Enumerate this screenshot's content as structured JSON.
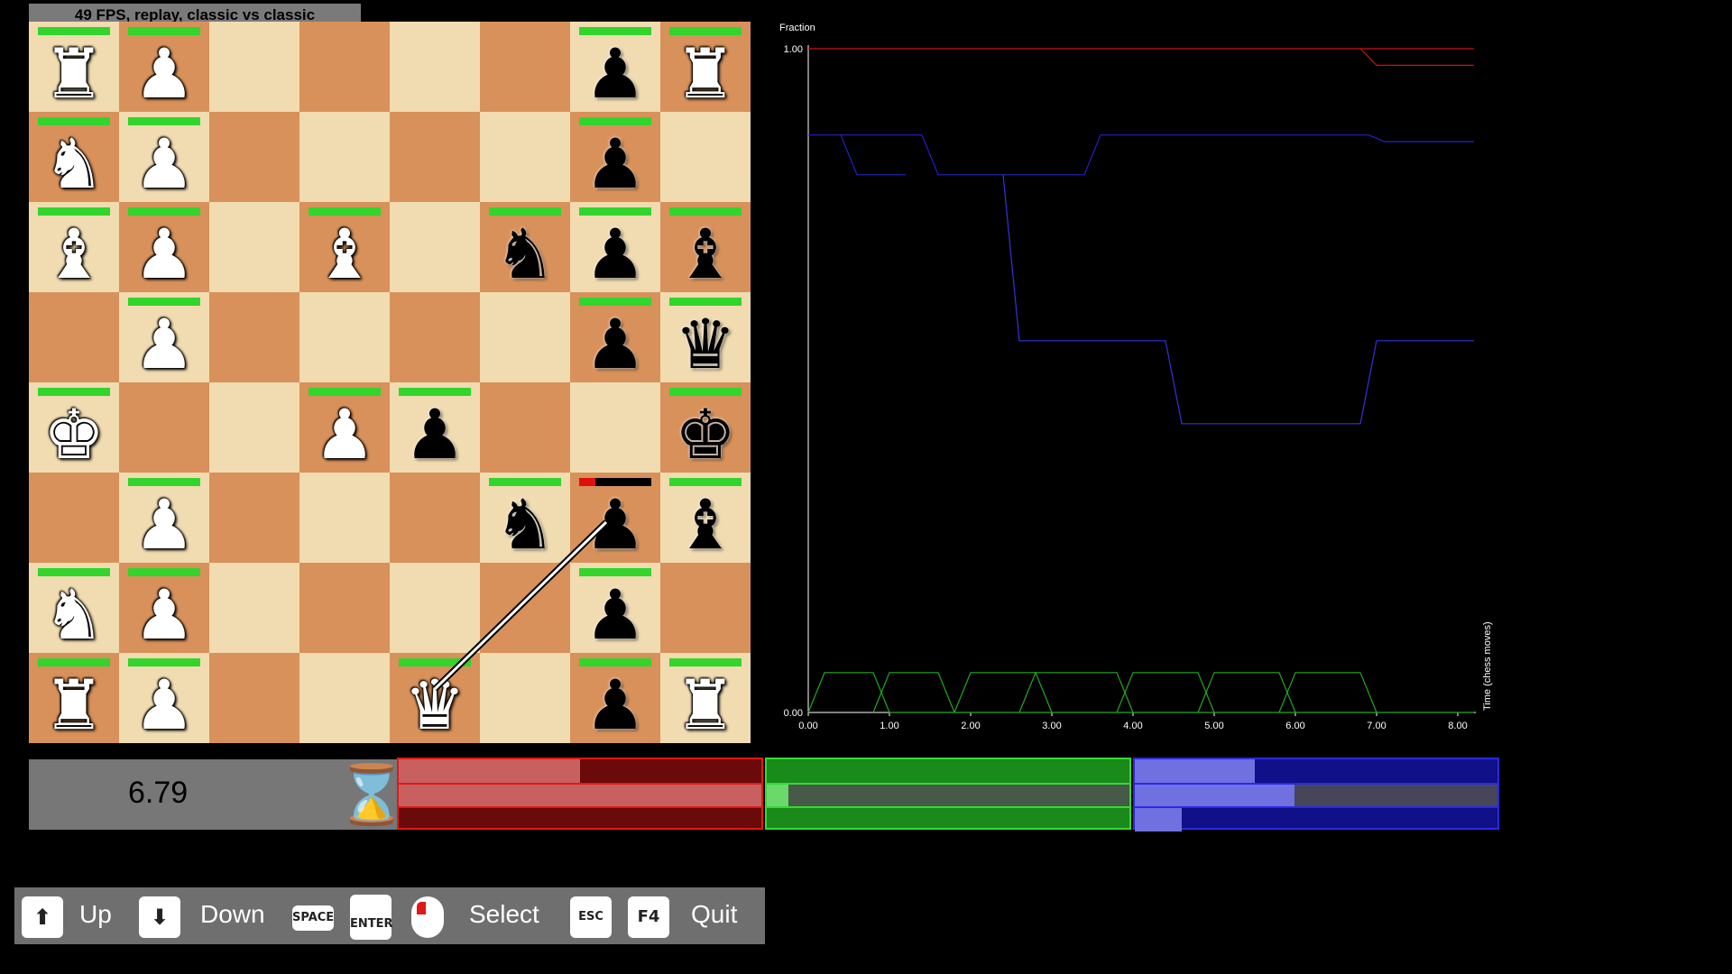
{
  "hud": {
    "fps_text": "49 FPS, replay, classic vs classic"
  },
  "board": {
    "rows": [
      [
        {
          "p": "♜",
          "c": "w",
          "hp": 1
        },
        {
          "p": "♟",
          "c": "w",
          "hp": 1
        },
        null,
        null,
        null,
        null,
        {
          "p": "♟",
          "c": "b",
          "hp": 1
        },
        {
          "p": "♜",
          "c": "w",
          "hp": 1
        }
      ],
      [
        {
          "p": "♞",
          "c": "w",
          "hp": 1
        },
        {
          "p": "♟",
          "c": "w",
          "hp": 1
        },
        null,
        null,
        null,
        null,
        {
          "p": "♟",
          "c": "b",
          "hp": 1
        },
        null
      ],
      [
        {
          "p": "♝",
          "c": "w",
          "hp": 1
        },
        {
          "p": "♟",
          "c": "w",
          "hp": 1
        },
        null,
        {
          "p": "♝",
          "c": "w",
          "hp": 1
        },
        null,
        {
          "p": "♞",
          "c": "b",
          "hp": 1
        },
        {
          "p": "♟",
          "c": "b",
          "hp": 1
        },
        {
          "p": "♝",
          "c": "b",
          "hp": 1
        }
      ],
      [
        null,
        {
          "p": "♟",
          "c": "w",
          "hp": 1
        },
        null,
        null,
        null,
        null,
        {
          "p": "♟",
          "c": "b",
          "hp": 1
        },
        {
          "p": "♛",
          "c": "b",
          "hp": 1
        }
      ],
      [
        {
          "p": "♚",
          "c": "w",
          "hp": 1
        },
        null,
        null,
        {
          "p": "♟",
          "c": "w",
          "hp": 1
        },
        {
          "p": "♟",
          "c": "b",
          "hp": 1
        },
        null,
        null,
        {
          "p": "♚",
          "c": "b",
          "hp": 1
        }
      ],
      [
        null,
        {
          "p": "♟",
          "c": "w",
          "hp": 1
        },
        null,
        null,
        null,
        {
          "p": "♞",
          "c": "b",
          "hp": 1
        },
        {
          "p": "♟",
          "c": "b",
          "hp": 0.22
        },
        {
          "p": "♝",
          "c": "b",
          "hp": 1
        }
      ],
      [
        {
          "p": "♞",
          "c": "w",
          "hp": 1
        },
        {
          "p": "♟",
          "c": "w",
          "hp": 1
        },
        null,
        null,
        null,
        null,
        {
          "p": "♟",
          "c": "b",
          "hp": 1
        },
        null
      ],
      [
        {
          "p": "♜",
          "c": "w",
          "hp": 1
        },
        {
          "p": "♟",
          "c": "w",
          "hp": 1
        },
        null,
        null,
        {
          "p": "♛",
          "c": "w",
          "hp": 1
        },
        null,
        {
          "p": "♟",
          "c": "b",
          "hp": 1
        },
        {
          "p": "♜",
          "c": "w",
          "hp": 1
        }
      ]
    ],
    "attack_line": {
      "from": [
        7,
        4
      ],
      "to": [
        5,
        6
      ]
    }
  },
  "chart_data": {
    "type": "line",
    "ylabel": "Fraction",
    "xlabel": "Time (chess moves)",
    "xlim": [
      0,
      8
    ],
    "ylim": [
      0,
      1
    ],
    "xticks": [
      "0.00",
      "1.00",
      "2.00",
      "3.00",
      "4.00",
      "5.00",
      "6.00",
      "7.00",
      "8.00"
    ],
    "yticks": [
      "0.00",
      "1.00"
    ],
    "series": [
      {
        "color": "#cc1111",
        "points": [
          [
            0,
            1
          ],
          [
            6.8,
            1
          ],
          [
            7.0,
            0.975
          ],
          [
            8.2,
            0.975
          ]
        ]
      },
      {
        "color": "#cc1111",
        "points": [
          [
            6.8,
            1
          ],
          [
            8.2,
            1
          ]
        ]
      },
      {
        "color": "#2222cc",
        "points": [
          [
            0,
            0.87
          ],
          [
            0.4,
            0.87
          ],
          [
            0.6,
            0.81
          ],
          [
            1.2,
            0.81
          ]
        ]
      },
      {
        "color": "#2222cc",
        "points": [
          [
            0.4,
            0.87
          ],
          [
            1.4,
            0.87
          ],
          [
            1.6,
            0.81
          ],
          [
            3.4,
            0.81
          ],
          [
            3.6,
            0.87
          ],
          [
            6.9,
            0.87
          ],
          [
            7.1,
            0.86
          ],
          [
            8.2,
            0.86
          ]
        ]
      },
      {
        "color": "#3333dd",
        "points": [
          [
            2.4,
            0.81
          ],
          [
            2.6,
            0.56
          ],
          [
            4.4,
            0.56
          ],
          [
            4.6,
            0.435
          ],
          [
            6.8,
            0.435
          ],
          [
            7.0,
            0.56
          ],
          [
            8.2,
            0.56
          ]
        ]
      },
      {
        "color": "#22aa22",
        "points": [
          [
            0,
            0
          ],
          [
            0.2,
            0.06
          ],
          [
            0.8,
            0.06
          ],
          [
            1.0,
            0
          ],
          [
            8.2,
            0
          ]
        ]
      },
      {
        "color": "#22aa22",
        "points": [
          [
            0.8,
            0
          ],
          [
            1.0,
            0.06
          ],
          [
            1.6,
            0.06
          ],
          [
            1.8,
            0
          ]
        ]
      },
      {
        "color": "#22aa22",
        "points": [
          [
            1.8,
            0
          ],
          [
            2.0,
            0.06
          ],
          [
            2.8,
            0.06
          ],
          [
            3.0,
            0
          ]
        ]
      },
      {
        "color": "#22aa22",
        "points": [
          [
            2.6,
            0
          ],
          [
            2.8,
            0.06
          ],
          [
            3.8,
            0.06
          ],
          [
            4.0,
            0
          ]
        ]
      },
      {
        "color": "#22aa22",
        "points": [
          [
            3.8,
            0
          ],
          [
            4.0,
            0.06
          ],
          [
            4.8,
            0.06
          ],
          [
            5.0,
            0
          ]
        ]
      },
      {
        "color": "#22aa22",
        "points": [
          [
            4.8,
            0
          ],
          [
            5.0,
            0.06
          ],
          [
            5.8,
            0.06
          ],
          [
            6.0,
            0
          ]
        ]
      },
      {
        "color": "#22aa22",
        "points": [
          [
            5.8,
            0
          ],
          [
            6.0,
            0.06
          ],
          [
            6.8,
            0.06
          ],
          [
            7.0,
            0
          ]
        ]
      }
    ]
  },
  "timer": {
    "value": "6.79",
    "icon": "hourglass-icon"
  },
  "resources": [
    {
      "name": "red",
      "border": "#e01818",
      "bg": "#6a0a0a",
      "fill": "#c96060",
      "rows": [
        0.5,
        1.0,
        0.0
      ]
    },
    {
      "name": "green",
      "border": "#35d935",
      "bg": "#1a8a1a",
      "fill": "#6ad86a",
      "rows": [
        0.0,
        0.06,
        0.0
      ]
    },
    {
      "name": "blue",
      "border": "#2a2ae0",
      "bg": "#101088",
      "fill": "#7070e0",
      "rows": [
        0.33,
        0.44,
        0.13
      ]
    }
  ],
  "controls": {
    "up_key": "⬆",
    "up_label": "Up",
    "down_key": "⬇",
    "down_label": "Down",
    "space_key": "SPACE",
    "enter_key": "ENTER",
    "mouse_icon": "mouse-icon",
    "select_label": "Select",
    "esc_key": "ESC",
    "f4_key": "F4",
    "quit_label": "Quit"
  }
}
